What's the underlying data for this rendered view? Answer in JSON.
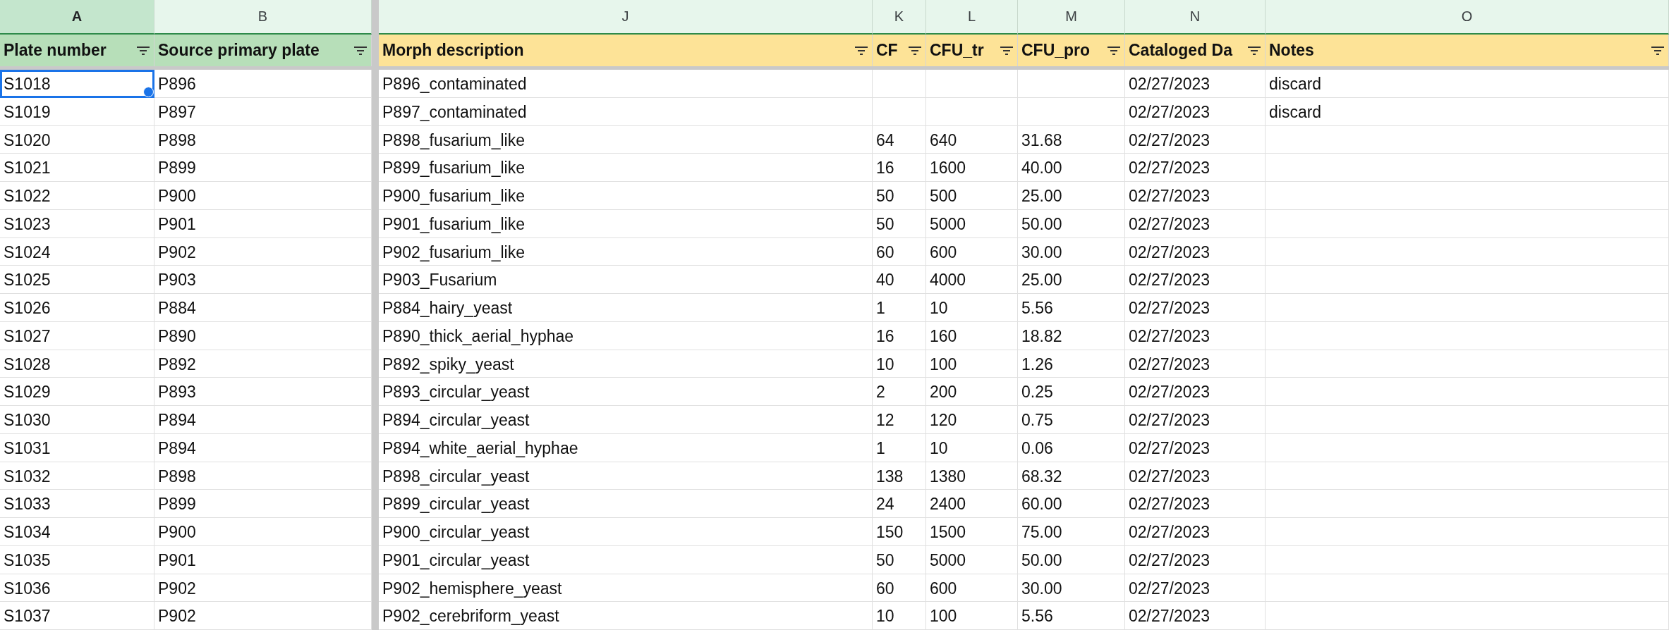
{
  "columns": [
    {
      "letter": "A",
      "title": "Plate number",
      "selected": true,
      "color": "#b7dfb9"
    },
    {
      "letter": "B",
      "title": "Source primary plate",
      "selected": false,
      "color": "#b7dfb9"
    },
    {
      "letter": "J",
      "title": "Morph description",
      "selected": false,
      "color": "#fde397"
    },
    {
      "letter": "K",
      "title": "CF",
      "selected": false,
      "color": "#fde397"
    },
    {
      "letter": "L",
      "title": "CFU_tr",
      "selected": false,
      "color": "#fde397"
    },
    {
      "letter": "M",
      "title": "CFU_pro",
      "selected": false,
      "color": "#fde397"
    },
    {
      "letter": "N",
      "title": "Cataloged Da",
      "selected": false,
      "color": "#fde397"
    },
    {
      "letter": "O",
      "title": "Notes",
      "selected": false,
      "color": "#fde397"
    }
  ],
  "rows": [
    {
      "selected": true,
      "cells": [
        "S1018",
        "P896",
        "P896_contaminated",
        "",
        "",
        "",
        "02/27/2023",
        "discard"
      ]
    },
    {
      "selected": false,
      "cells": [
        "S1019",
        "P897",
        "P897_contaminated",
        "",
        "",
        "",
        "02/27/2023",
        "discard"
      ]
    },
    {
      "selected": false,
      "cells": [
        "S1020",
        "P898",
        "P898_fusarium_like",
        "64",
        "640",
        "31.68",
        "02/27/2023",
        ""
      ]
    },
    {
      "selected": false,
      "cells": [
        "S1021",
        "P899",
        "P899_fusarium_like",
        "16",
        "1600",
        "40.00",
        "02/27/2023",
        ""
      ]
    },
    {
      "selected": false,
      "cells": [
        "S1022",
        "P900",
        "P900_fusarium_like",
        "50",
        "500",
        "25.00",
        "02/27/2023",
        ""
      ]
    },
    {
      "selected": false,
      "cells": [
        "S1023",
        "P901",
        "P901_fusarium_like",
        "50",
        "5000",
        "50.00",
        "02/27/2023",
        ""
      ]
    },
    {
      "selected": false,
      "cells": [
        "S1024",
        "P902",
        "P902_fusarium_like",
        "60",
        "600",
        "30.00",
        "02/27/2023",
        ""
      ]
    },
    {
      "selected": false,
      "cells": [
        "S1025",
        "P903",
        "P903_Fusarium",
        "40",
        "4000",
        "25.00",
        "02/27/2023",
        ""
      ]
    },
    {
      "selected": false,
      "cells": [
        "S1026",
        "P884",
        "P884_hairy_yeast",
        "1",
        "10",
        "5.56",
        "02/27/2023",
        ""
      ]
    },
    {
      "selected": false,
      "cells": [
        "S1027",
        "P890",
        "P890_thick_aerial_hyphae",
        "16",
        "160",
        "18.82",
        "02/27/2023",
        ""
      ]
    },
    {
      "selected": false,
      "cells": [
        "S1028",
        "P892",
        "P892_spiky_yeast",
        "10",
        "100",
        "1.26",
        "02/27/2023",
        ""
      ]
    },
    {
      "selected": false,
      "cells": [
        "S1029",
        "P893",
        "P893_circular_yeast",
        "2",
        "200",
        "0.25",
        "02/27/2023",
        ""
      ]
    },
    {
      "selected": false,
      "cells": [
        "S1030",
        "P894",
        "P894_circular_yeast",
        "12",
        "120",
        "0.75",
        "02/27/2023",
        ""
      ]
    },
    {
      "selected": false,
      "cells": [
        "S1031",
        "P894",
        "P894_white_aerial_hyphae",
        "1",
        "10",
        "0.06",
        "02/27/2023",
        ""
      ]
    },
    {
      "selected": false,
      "cells": [
        "S1032",
        "P898",
        "P898_circular_yeast",
        "138",
        "1380",
        "68.32",
        "02/27/2023",
        ""
      ]
    },
    {
      "selected": false,
      "cells": [
        "S1033",
        "P899",
        "P899_circular_yeast",
        "24",
        "2400",
        "60.00",
        "02/27/2023",
        ""
      ]
    },
    {
      "selected": false,
      "cells": [
        "S1034",
        "P900",
        "P900_circular_yeast",
        "150",
        "1500",
        "75.00",
        "02/27/2023",
        ""
      ]
    },
    {
      "selected": false,
      "cells": [
        "S1035",
        "P901",
        "P901_circular_yeast",
        "50",
        "5000",
        "50.00",
        "02/27/2023",
        ""
      ]
    },
    {
      "selected": false,
      "cells": [
        "S1036",
        "P902",
        "P902_hemisphere_yeast",
        "60",
        "600",
        "30.00",
        "02/27/2023",
        ""
      ]
    },
    {
      "selected": false,
      "cells": [
        "S1037",
        "P902",
        "P902_cerebriform_yeast",
        "10",
        "100",
        "5.56",
        "02/27/2023",
        ""
      ]
    }
  ]
}
